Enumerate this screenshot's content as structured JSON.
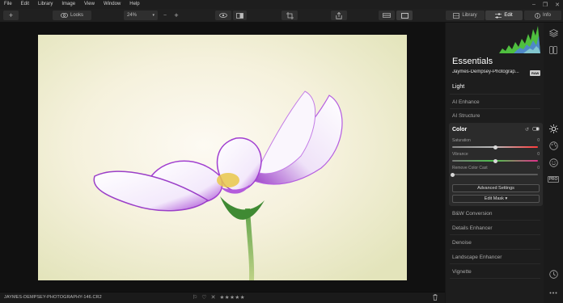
{
  "menu": [
    "File",
    "Edit",
    "Library",
    "Image",
    "View",
    "Window",
    "Help"
  ],
  "window_controls": {
    "minimize": "–",
    "restore": "❐",
    "close": "✕"
  },
  "toolbar": {
    "add_label": "+",
    "looks_label": "Looks",
    "zoom_value": "24%",
    "zoom_minus": "–",
    "zoom_plus": "+",
    "library_label": "Library",
    "edit_label": "Edit",
    "info_label": "Info"
  },
  "status": {
    "filename": "JAYMES-DEMPSEY-PHOTOGRAPHY-146.CR2",
    "rating_stars": "★★★★★",
    "flag": "⚐",
    "heart": "♡",
    "reject": "✕"
  },
  "panel": {
    "title": "Essentials",
    "photo_name": "Jaymes-Dempsey-Photograp...",
    "raw_badge": "RAW",
    "light_label": "Light",
    "ai_enhance_label": "AI Enhance",
    "ai_structure_label": "AI Structure",
    "color": {
      "title": "Color",
      "saturation_label": "Saturation",
      "saturation_value": "0",
      "vibrance_label": "Vibrance",
      "vibrance_value": "0",
      "remove_cast_label": "Remove Color Cast",
      "remove_cast_value": "0",
      "advanced_button": "Advanced Settings",
      "edit_mask_button": "Edit Mask ▾",
      "saturation_level": 0.5,
      "vibrance_level": 0.5,
      "remove_cast_level": 0.0
    },
    "lower_items": [
      "B&W Conversion",
      "Details Enhancer",
      "Denoise",
      "Landscape Enhancer",
      "Vignette"
    ]
  },
  "colors": {
    "panel_bg": "#1d1d1d",
    "active_tab": "#3c3c3c",
    "histogram_green": "#4fbf3f",
    "histogram_blue": "#4f7fdf",
    "flower_purple": "#9b3fc8"
  }
}
